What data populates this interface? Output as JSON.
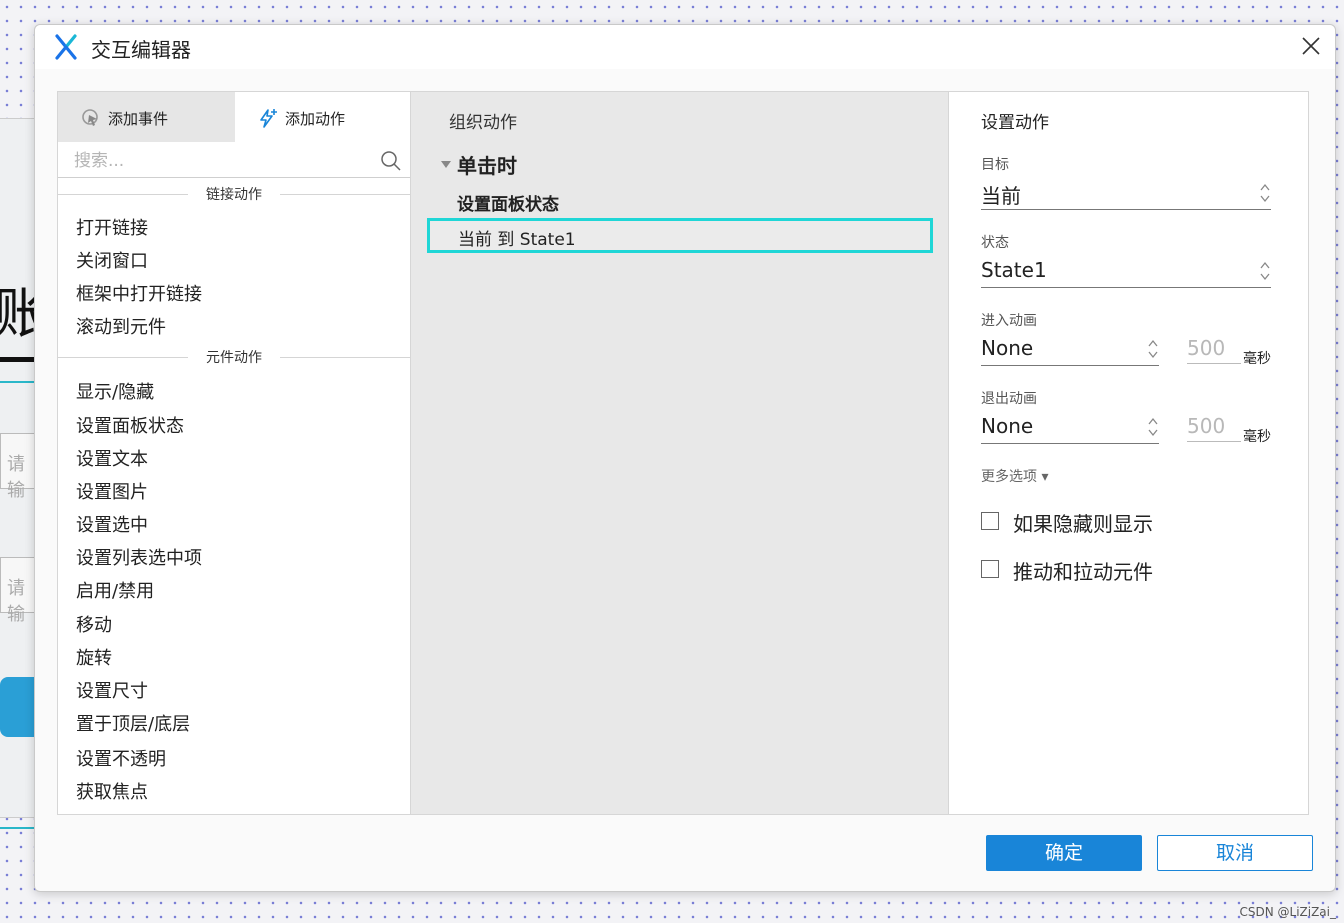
{
  "background": {
    "partial_text": "账",
    "input1_placeholder": "请输",
    "input2_placeholder": "请输"
  },
  "dialog": {
    "title": "交互编辑器"
  },
  "left_panel": {
    "tabs": [
      {
        "label": "添加事件"
      },
      {
        "label": "添加动作"
      }
    ],
    "search_placeholder": "搜索...",
    "sections": [
      {
        "header": "链接动作",
        "items": [
          "打开链接",
          "关闭窗口",
          "框架中打开链接",
          "滚动到元件"
        ]
      },
      {
        "header": "元件动作",
        "items": [
          "显示/隐藏",
          "设置面板状态",
          "设置文本",
          "设置图片",
          "设置选中",
          "设置列表选中项",
          "启用/禁用",
          "移动",
          "旋转",
          "设置尺寸",
          "置于顶层/底层",
          "设置不透明",
          "获取焦点"
        ]
      }
    ]
  },
  "middle_panel": {
    "title": "组织动作",
    "event": "单击时",
    "case": "设置面板状态",
    "action": "当前 到 State1"
  },
  "right_panel": {
    "title": "设置动作",
    "target_label": "目标",
    "target_value": "当前",
    "state_label": "状态",
    "state_value": "State1",
    "enter_anim_label": "进入动画",
    "enter_anim_value": "None",
    "enter_ms": "500",
    "exit_anim_label": "退出动画",
    "exit_anim_value": "None",
    "exit_ms": "500",
    "ms_unit": "毫秒",
    "more_options": "更多选项 ▾",
    "checkbox1": "如果隐藏则显示",
    "checkbox2": "推动和拉动元件"
  },
  "footer": {
    "ok": "确定",
    "cancel": "取消"
  },
  "watermark": "CSDN @LiZiZai_",
  "colors": {
    "accent": "#1985d8",
    "highlight": "#1fd6d6"
  }
}
